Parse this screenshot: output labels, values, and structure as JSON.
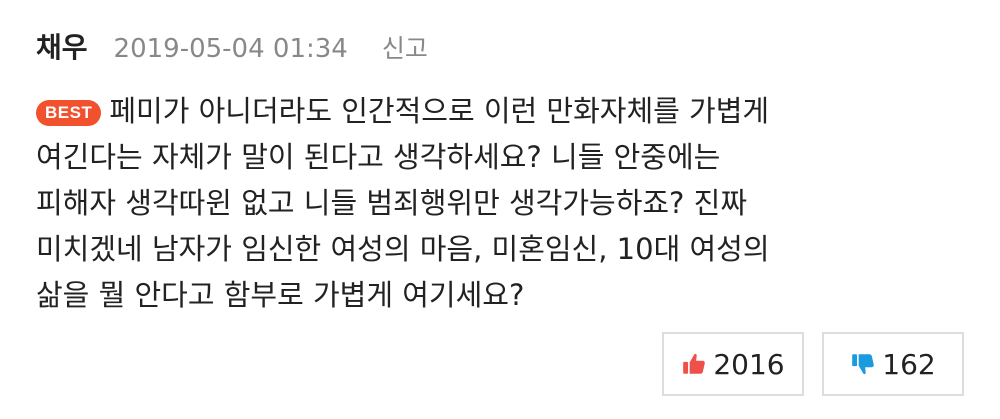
{
  "comment": {
    "author": "채우",
    "timestamp": "2019-05-04 01:34",
    "report_label": "신고",
    "badge": "BEST",
    "lines": [
      "페미가 아니더라도 인간적으로 이런 만화자체를 가볍게",
      "여긴다는 자체가 말이 된다고 생각하세요? 니들 안중에는",
      "피해자 생각따윈 없고 니들 범죄행위만 생각가능하죠? 진짜",
      "미치겠네 남자가 임신한 여성의 마음, 미혼임신, 10대 여성의",
      "삶을 뭘 안다고 함부로 가볍게 여기세요?"
    ]
  },
  "votes": {
    "like": {
      "count": "2016",
      "icon": "thumbs-up-icon",
      "color": "#f0504a"
    },
    "dislike": {
      "count": "162",
      "icon": "thumbs-down-icon",
      "color": "#1a9be0"
    }
  },
  "colors": {
    "badge": "#f2512d",
    "meta_text": "#888888",
    "border": "#dddddd"
  }
}
